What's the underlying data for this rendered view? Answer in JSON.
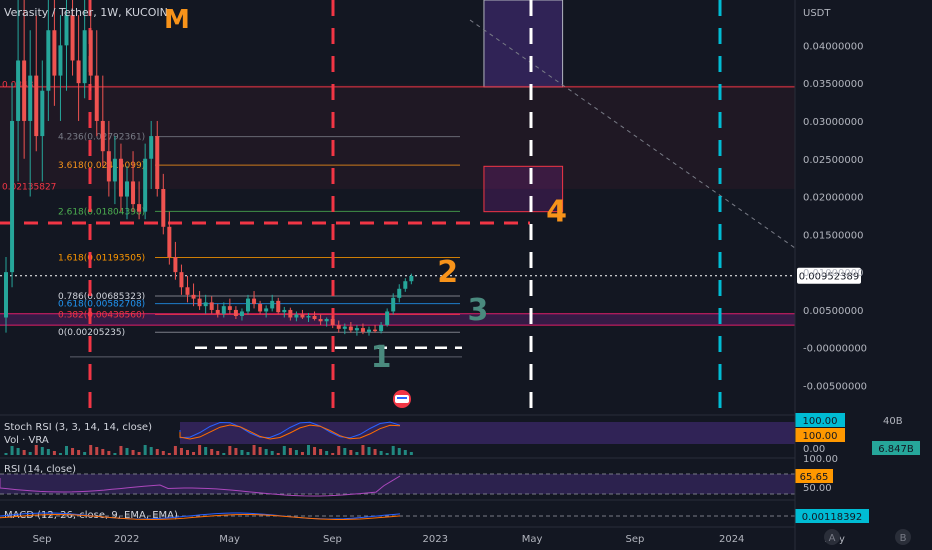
{
  "header": {
    "title": "Verasity / Tether, 1W, KUCOIN",
    "logo_letter": "M",
    "currency": "USDT"
  },
  "colors": {
    "background": "#131722",
    "bull": "#26a69a",
    "bear": "#ef5350",
    "red_dash": "#f23645",
    "cyan_dash": "#22ab94",
    "wave_orange": "#f7931a",
    "wave_teal": "#4a8a7e",
    "stoch_bg": "#2a1f4d",
    "rsi_bg": "#2a1f4d",
    "price_label_bg": "#ffffff"
  },
  "chart_data": {
    "type": "candlestick",
    "price_axis": {
      "ticks": [
        "0.04000000",
        "0.03500000",
        "0.03000000",
        "0.02500000",
        "0.02000000",
        "0.01500000",
        "0.01000000",
        "0.00500000",
        "-0.00000000",
        "-0.00500000"
      ],
      "tick_values": [
        0.04,
        0.035,
        0.03,
        0.025,
        0.02,
        0.015,
        0.01,
        0.005,
        0,
        -0.005
      ],
      "ylim": [
        -0.0085,
        0.046
      ],
      "current_price": "0.00952389",
      "current_price_value": 0.00952389
    },
    "time_axis": {
      "labels": [
        "Sep",
        "2022",
        "May",
        "Sep",
        "2023",
        "May",
        "Sep",
        "2024",
        "May"
      ],
      "label_index": [
        0,
        14,
        31,
        48,
        65,
        81,
        98,
        114,
        131
      ]
    },
    "series": {
      "ohlc": [
        [
          0.004,
          0.012,
          0.002,
          0.01
        ],
        [
          0.01,
          0.035,
          0.008,
          0.03
        ],
        [
          0.03,
          0.046,
          0.022,
          0.038
        ],
        [
          0.038,
          0.046,
          0.025,
          0.03
        ],
        [
          0.03,
          0.042,
          0.02,
          0.036
        ],
        [
          0.036,
          0.044,
          0.026,
          0.028
        ],
        [
          0.028,
          0.038,
          0.022,
          0.034
        ],
        [
          0.034,
          0.046,
          0.03,
          0.042
        ],
        [
          0.042,
          0.046,
          0.032,
          0.036
        ],
        [
          0.036,
          0.044,
          0.03,
          0.04
        ],
        [
          0.04,
          0.046,
          0.034,
          0.044
        ],
        [
          0.044,
          0.046,
          0.036,
          0.038
        ],
        [
          0.038,
          0.044,
          0.03,
          0.035
        ],
        [
          0.035,
          0.046,
          0.033,
          0.042
        ],
        [
          0.042,
          0.046,
          0.034,
          0.036
        ],
        [
          0.036,
          0.042,
          0.028,
          0.03
        ],
        [
          0.03,
          0.036,
          0.024,
          0.026
        ],
        [
          0.026,
          0.03,
          0.02,
          0.022
        ],
        [
          0.022,
          0.028,
          0.019,
          0.025
        ],
        [
          0.025,
          0.027,
          0.018,
          0.02
        ],
        [
          0.02,
          0.024,
          0.017,
          0.022
        ],
        [
          0.022,
          0.026,
          0.018,
          0.019
        ],
        [
          0.019,
          0.022,
          0.017,
          0.018
        ],
        [
          0.018,
          0.027,
          0.017,
          0.025
        ],
        [
          0.025,
          0.03,
          0.021,
          0.028
        ],
        [
          0.028,
          0.03,
          0.02,
          0.021
        ],
        [
          0.021,
          0.023,
          0.015,
          0.016
        ],
        [
          0.016,
          0.018,
          0.011,
          0.012
        ],
        [
          0.012,
          0.014,
          0.009,
          0.01
        ],
        [
          0.01,
          0.011,
          0.007,
          0.008
        ],
        [
          0.008,
          0.0095,
          0.006,
          0.007
        ],
        [
          0.007,
          0.0085,
          0.0055,
          0.0065
        ],
        [
          0.0065,
          0.0075,
          0.005,
          0.0055
        ],
        [
          0.0055,
          0.007,
          0.0045,
          0.006
        ],
        [
          0.006,
          0.0068,
          0.0045,
          0.005
        ],
        [
          0.005,
          0.0058,
          0.004,
          0.0045
        ],
        [
          0.0045,
          0.006,
          0.004,
          0.0055
        ],
        [
          0.0055,
          0.0065,
          0.0045,
          0.005
        ],
        [
          0.005,
          0.0055,
          0.0038,
          0.0042
        ],
        [
          0.0042,
          0.0052,
          0.0036,
          0.0048
        ],
        [
          0.0048,
          0.007,
          0.0044,
          0.0065
        ],
        [
          0.0065,
          0.0075,
          0.0052,
          0.0058
        ],
        [
          0.0058,
          0.0062,
          0.0045,
          0.0048
        ],
        [
          0.0048,
          0.0056,
          0.004,
          0.0052
        ],
        [
          0.0052,
          0.007,
          0.0048,
          0.0062
        ],
        [
          0.0062,
          0.0066,
          0.0045,
          0.0047
        ],
        [
          0.0047,
          0.0054,
          0.004,
          0.005
        ],
        [
          0.005,
          0.0053,
          0.0036,
          0.004
        ],
        [
          0.004,
          0.0048,
          0.0035,
          0.0044
        ],
        [
          0.0044,
          0.005,
          0.0038,
          0.004
        ],
        [
          0.004,
          0.0046,
          0.0034,
          0.0042
        ],
        [
          0.0042,
          0.0048,
          0.0036,
          0.0038
        ],
        [
          0.0038,
          0.0044,
          0.003,
          0.0035
        ],
        [
          0.0035,
          0.004,
          0.0028,
          0.0038
        ],
        [
          0.0038,
          0.0042,
          0.0026,
          0.003
        ],
        [
          0.003,
          0.0036,
          0.002,
          0.0025
        ],
        [
          0.0025,
          0.0032,
          0.0018,
          0.0028
        ],
        [
          0.0028,
          0.0034,
          0.002,
          0.0023
        ],
        [
          0.0023,
          0.003,
          0.0016,
          0.0026
        ],
        [
          0.0026,
          0.0032,
          0.0018,
          0.0021
        ],
        [
          0.0021,
          0.0028,
          0.0016,
          0.0024
        ],
        [
          0.0024,
          0.003,
          0.002,
          0.0022
        ],
        [
          0.0022,
          0.0034,
          0.0019,
          0.003
        ],
        [
          0.003,
          0.0052,
          0.0028,
          0.0048
        ],
        [
          0.0048,
          0.0072,
          0.0044,
          0.0066
        ],
        [
          0.0066,
          0.0084,
          0.006,
          0.0078
        ],
        [
          0.0078,
          0.0092,
          0.0074,
          0.0088
        ],
        [
          0.0088,
          0.0098,
          0.0084,
          0.0095
        ]
      ]
    },
    "fib_levels": [
      {
        "label": "4.236(0.02792361)",
        "value": 0.02792
      },
      {
        "label": "3.618(0.02415099)",
        "value": 0.02415
      },
      {
        "label": "2.618(0.01804398)",
        "value": 0.01804
      },
      {
        "label": "1.618(0.01193505)",
        "value": 0.01194
      },
      {
        "label": "0.786(0.00685323)",
        "value": 0.00685
      },
      {
        "label": "0.618(0.00582708)",
        "value": 0.00583
      },
      {
        "label": "0.382(0.00438560)",
        "value": 0.00439
      },
      {
        "label": "0(0.00205235)",
        "value": 0.00205
      }
    ],
    "left_price_labels": [
      {
        "label": "0.0348",
        "value": 0.0348
      },
      {
        "label": "0.02135827",
        "value": 0.02136
      }
    ],
    "wave_labels": [
      {
        "label": "1",
        "value": -0.0012,
        "index": 62
      },
      {
        "label": "2",
        "value": 0.01,
        "index": 73
      },
      {
        "label": "3",
        "value": 0.005,
        "index": 78
      },
      {
        "label": "4",
        "value": 0.018,
        "index": 91
      }
    ],
    "zones": [
      {
        "name": "upper-purple-box",
        "top": 0.046,
        "bottom": 0.0345,
        "index_start": 79,
        "index_end": 92
      },
      {
        "name": "target-box-4",
        "top": 0.024,
        "bottom": 0.018,
        "index_start": 79,
        "index_end": 92
      }
    ],
    "horizontal_levels": [
      {
        "name": "resistance-line",
        "value": 0.0345
      },
      {
        "name": "red-dashed-level",
        "value": 0.0165
      },
      {
        "name": "support-band-top",
        "value": 0.0045
      },
      {
        "name": "support-band-bottom",
        "value": 0.003
      }
    ],
    "stoch_rsi": {
      "label": "Stoch RSI (3, 3, 14, 14, close)",
      "values": [
        "100.00",
        "100.00"
      ],
      "axis": [
        "0.00"
      ]
    },
    "volume": {
      "label": "Vol · VRA",
      "axis_max": "40B",
      "value": "6.847B"
    },
    "rsi": {
      "label": "RSI (14, close)",
      "value": "65.65",
      "axis": [
        "100.00",
        "50.00"
      ]
    },
    "macd": {
      "label": "MACD (12, 26, close, 9, EMA, EMA)",
      "value": "0.00118392"
    }
  },
  "footer": {
    "auto_button": "A",
    "log_button": "B"
  }
}
